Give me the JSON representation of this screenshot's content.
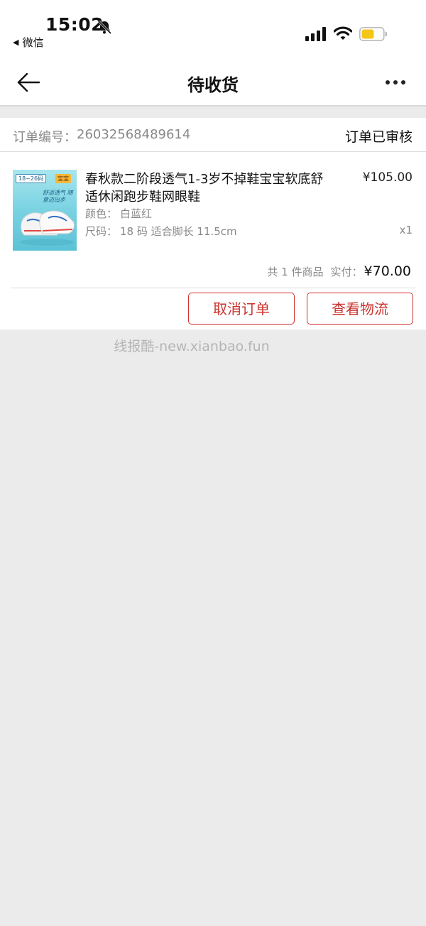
{
  "status_bar": {
    "time": "15:02",
    "back_app_label": "微信",
    "back_arrow": "◀",
    "icons": [
      "bell-muted-icon",
      "signal-icon",
      "wifi-icon",
      "battery-icon"
    ],
    "battery_color": "#f5c518"
  },
  "nav": {
    "title": "待收货",
    "back_icon": "arrow-left-icon",
    "more_icon": "more-dots-icon"
  },
  "order": {
    "number_label": "订单编号：",
    "number": "26032568489614",
    "status": "订单已审核",
    "item": {
      "image_tags": [
        "18~26码",
        "宝宝"
      ],
      "image_slogan": "舒适透气 随意迈出步",
      "name": "春秋款二阶段透气1-3岁不掉鞋宝宝软底舒适休闲跑步鞋网眼鞋",
      "price": "¥105.00",
      "color_label": "颜色：",
      "color_value": "白蓝红",
      "size_label": "尺码：",
      "size_value": "18 码 适合脚长 11.5cm",
      "quantity": "x1"
    },
    "total_count": "共 1 件商品",
    "paid_label": "实付：",
    "paid_amount": "¥70.00",
    "buttons": {
      "cancel": "取消订单",
      "track": "查看物流"
    },
    "accent_color": "#c9322d"
  },
  "watermark": "线报酷-new.xianbao.fun"
}
